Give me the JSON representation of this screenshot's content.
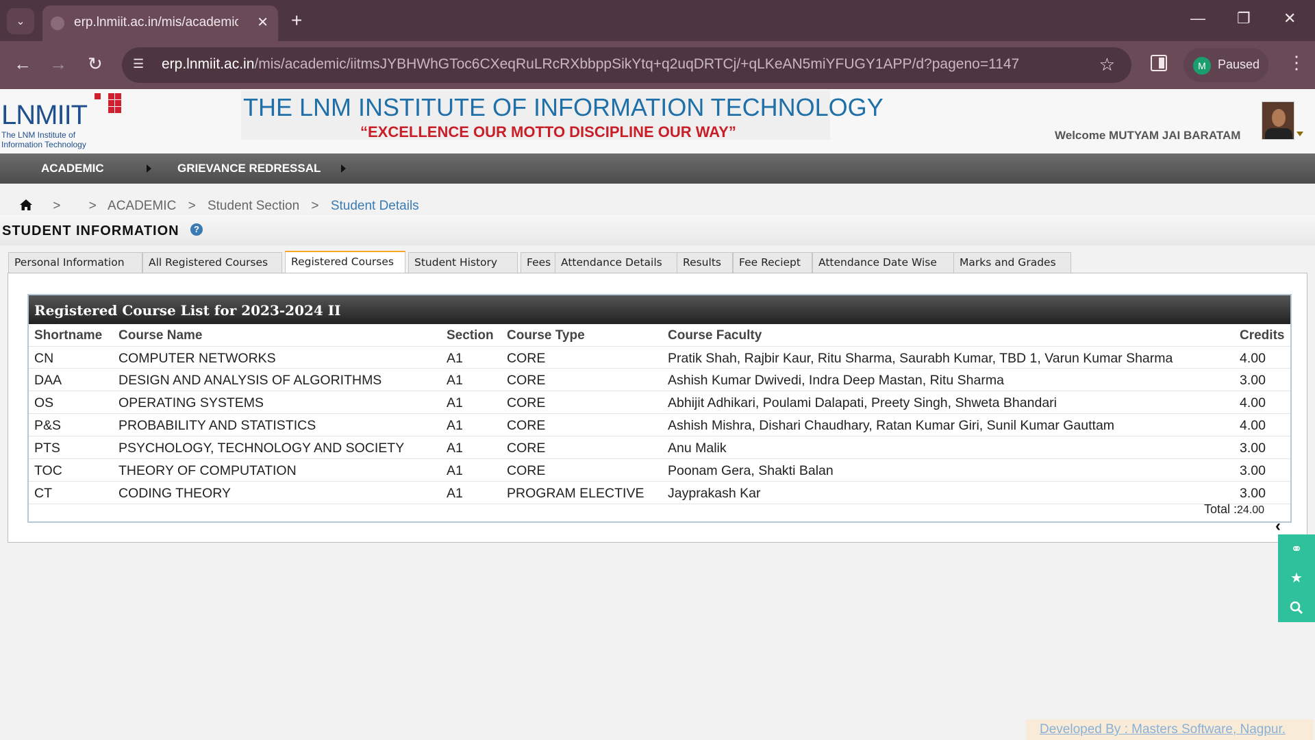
{
  "browser": {
    "tab_title": "erp.lnmiit.ac.in/mis/academic/ii",
    "url_host": "erp.lnmiit.ac.in",
    "url_path": "/mis/academic/iitmsJYBHWhGToc6CXeqRuLRcRXbbppSikYtq+q2uqDRTCj/+qLKeAN5miYFUGY1APP/d?pageno=1147",
    "profile_initial": "M",
    "profile_status": "Paused"
  },
  "header": {
    "logo_name": "LNMIIT",
    "logo_sub": "The LNM Institute of Information Technology",
    "institute_title": "THE LNM INSTITUTE OF INFORMATION TECHNOLOGY",
    "motto": "“EXCELLENCE OUR MOTTO DISCIPLINE OUR WAY”",
    "welcome": "Welcome MUTYAM JAI BARATAM"
  },
  "mainnav": {
    "items": [
      "ACADEMIC",
      "GRIEVANCE REDRESSAL"
    ]
  },
  "breadcrumb": {
    "sep": ">",
    "items": [
      "ACADEMIC",
      "Student Section",
      "Student Details"
    ]
  },
  "section": {
    "title": "STUDENT INFORMATION",
    "help": "?"
  },
  "tabs": [
    "Personal Information",
    "All Registered Courses",
    "Registered Courses",
    "Student History",
    "Fees",
    "Attendance Details",
    "Results",
    "Fee Reciept",
    "Attendance Date Wise",
    "Marks and Grades"
  ],
  "courses": {
    "title": "Registered Course List for 2023-2024 II",
    "columns": [
      "Shortname",
      "Course Name",
      "Section",
      "Course Type",
      "Course Faculty",
      "Credits"
    ],
    "rows": [
      [
        "CN",
        "COMPUTER NETWORKS",
        "A1",
        "CORE",
        "Pratik Shah, Rajbir Kaur, Ritu Sharma, Saurabh Kumar, TBD 1, Varun Kumar Sharma",
        "4.00"
      ],
      [
        "DAA",
        "DESIGN AND ANALYSIS OF ALGORITHMS",
        "A1",
        "CORE",
        "Ashish Kumar Dwivedi, Indra Deep Mastan, Ritu Sharma",
        "3.00"
      ],
      [
        "OS",
        "OPERATING SYSTEMS",
        "A1",
        "CORE",
        "Abhijit Adhikari, Poulami Dalapati, Preety Singh, Shweta Bhandari",
        "4.00"
      ],
      [
        "P&S",
        "PROBABILITY AND STATISTICS",
        "A1",
        "CORE",
        "Ashish Mishra, Dishari Chaudhary, Ratan Kumar Giri, Sunil Kumar Gauttam",
        "4.00"
      ],
      [
        "PTS",
        "PSYCHOLOGY, TECHNOLOGY AND SOCIETY",
        "A1",
        "CORE",
        "Anu Malik",
        "3.00"
      ],
      [
        "TOC",
        "THEORY OF COMPUTATION",
        "A1",
        "CORE",
        "Poonam Gera, Shakti Balan",
        "3.00"
      ],
      [
        "CT",
        "CODING THEORY",
        "A1",
        "PROGRAM ELECTIVE",
        "Jayprakash Kar",
        "3.00"
      ]
    ],
    "total_label": "Total :",
    "total_value": "24.00"
  },
  "footer": {
    "developed_by": "Developed By : Masters Software, Nagpur."
  },
  "colors": {
    "accent_tab": "#f5a623",
    "brand_blue": "#1f6fa8",
    "motto_red": "#c81e28",
    "side_widget": "#2ec19b"
  }
}
